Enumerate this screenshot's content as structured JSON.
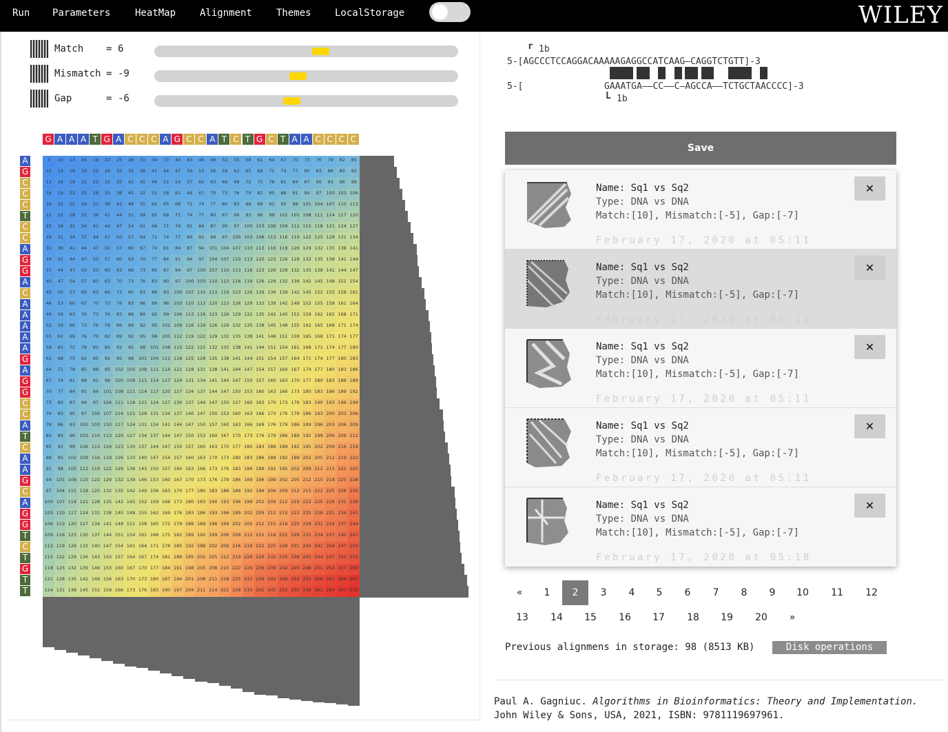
{
  "nav": {
    "items": [
      "Run",
      "Parameters",
      "HeatMap",
      "Alignment",
      "Themes",
      "LocalStorage"
    ],
    "toggle_on": false,
    "logo": "WILEY"
  },
  "parameters": [
    {
      "label": "Match",
      "value": "6",
      "slider_fraction": 0.55
    },
    {
      "label": "Mismatch",
      "value": "-9",
      "slider_fraction": 0.47
    },
    {
      "label": "Gap",
      "value": "-6",
      "slider_fraction": 0.45
    }
  ],
  "sequences": {
    "top": "GAAATGACCCAGCCATCTGCTAACCCC",
    "left": "AGCCCTCCAGGACAAAAAGAGGCCATCAAGCAGGTCTGTT",
    "colors": {
      "A": "#3a5bbf",
      "C": "#d4af4c",
      "G": "#e0243d",
      "T": "#4e6b3a"
    }
  },
  "alignment": {
    "top_marker": "1b",
    "line1": "5-[AGCCCTCCAGGACAAAAAGAGGCCATCAAG—CAGGTCTGTT]-3",
    "line2_prefix": "5-[",
    "line2": "GAAATGA——CC——C—AGCCA——TCTGCTAACCCC]-3",
    "bottom_marker": "1b",
    "match_cols": [
      0,
      1,
      2,
      3,
      5,
      6,
      9,
      12,
      14,
      15,
      17,
      18,
      22,
      23,
      24,
      25,
      28
    ]
  },
  "save_label": "Save",
  "saved": [
    {
      "name": "Name: Sq1 vs Sq2",
      "type": "Type: DNA vs DNA",
      "params": "Match:[10], Mismatch:[-5], Gap:[-7]",
      "date": "February 17, 2020 at 05:11",
      "close": "✕",
      "selected": false
    },
    {
      "name": "Name: Sq1 vs Sq2",
      "type": "Type: DNA vs DNA",
      "params": "Match:[10], Mismatch:[-5], Gap:[-7]",
      "date": "February 17, 2020 at 05:11",
      "close": "✕",
      "selected": true
    },
    {
      "name": "Name: Sq1 vs Sq2",
      "type": "Type: DNA vs DNA",
      "params": "Match:[10], Mismatch:[-5], Gap:[-7]",
      "date": "February 17, 2020 at 05:11",
      "close": "✕",
      "selected": false
    },
    {
      "name": "Name: Sq1 vs Sq2",
      "type": "Type: DNA vs DNA",
      "params": "Match:[10], Mismatch:[-5], Gap:[-7]",
      "date": "February 17, 2020 at 05:11",
      "close": "✕",
      "selected": false
    },
    {
      "name": "Name: Sq1 vs Sq2",
      "type": "Type: DNA vs DNA",
      "params": "Match:[10], Mismatch:[-5], Gap:[-7]",
      "date": "February 17, 2020 at 05:10",
      "close": "✕",
      "selected": false
    }
  ],
  "pagination": {
    "row1": [
      "«",
      "1",
      "2",
      "3",
      "4",
      "5",
      "6",
      "7",
      "8",
      "9",
      "10",
      "11",
      "12"
    ],
    "row2": [
      "13",
      "14",
      "15",
      "16",
      "17",
      "18",
      "19",
      "20",
      "»"
    ],
    "active": "2"
  },
  "storage": {
    "text": "Previous alignmens in storage: 98 (8513 KB)",
    "disk_button": "Disk operations"
  },
  "citation": {
    "author": "Paul A. Gagniuc.",
    "title": "Algorithms in Bioinformatics: Theory and Implementation.",
    "publisher": "John Wiley & Sons, USA, 2021, ISBN: 9781119697961."
  }
}
